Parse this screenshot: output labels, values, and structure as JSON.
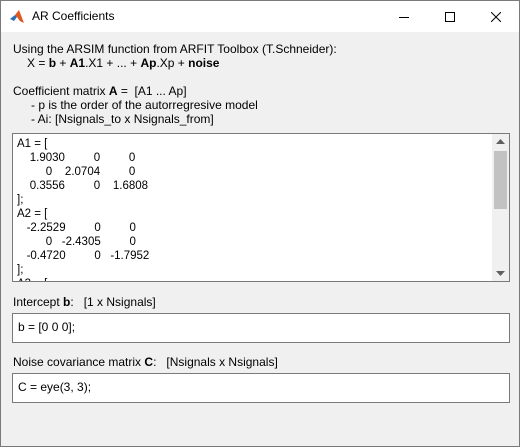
{
  "window": {
    "title": "AR Coefficients",
    "minimize_icon": "minimize-icon",
    "maximize_icon": "maximize-icon",
    "close_icon": "close-icon",
    "app_icon": "matlab-icon"
  },
  "intro": {
    "line1": "Using the ARSIM function from ARFIT Toolbox (T.Schneider):",
    "eq_x": "X = ",
    "eq_b": "b",
    "eq_plus1": " + ",
    "eq_A1": "A1",
    "eq_x1": ".X1 + ... + ",
    "eq_Ap": "Ap",
    "eq_xp": ".Xp + ",
    "eq_noise": "noise"
  },
  "coeff": {
    "label_prefix": "Coefficient matrix ",
    "label_bold": "A",
    "label_suffix": " =  [A1 ... Ap]",
    "note1": "- p is the order of the autorregresive model",
    "note2": "- Ai: [Nsignals_to x Nsignals_from]",
    "text": "A1 = [\n    1.9030         0         0\n         0    2.0704         0\n    0.3556         0    1.6808\n];\nA2 = [\n   -2.2529         0         0\n         0   -2.4305         0\n   -0.4720         0   -1.7952\n];\nA3 = ["
  },
  "intercept": {
    "label_prefix": "Intercept ",
    "label_bold": "b",
    "label_suffix": ":   [1 x Nsignals]",
    "value": "b = [0 0 0];"
  },
  "noise": {
    "label_prefix": "Noise covariance matrix ",
    "label_bold": "C",
    "label_suffix": ":   [Nsignals x Nsignals]",
    "value": "C = eye(3, 3);"
  }
}
